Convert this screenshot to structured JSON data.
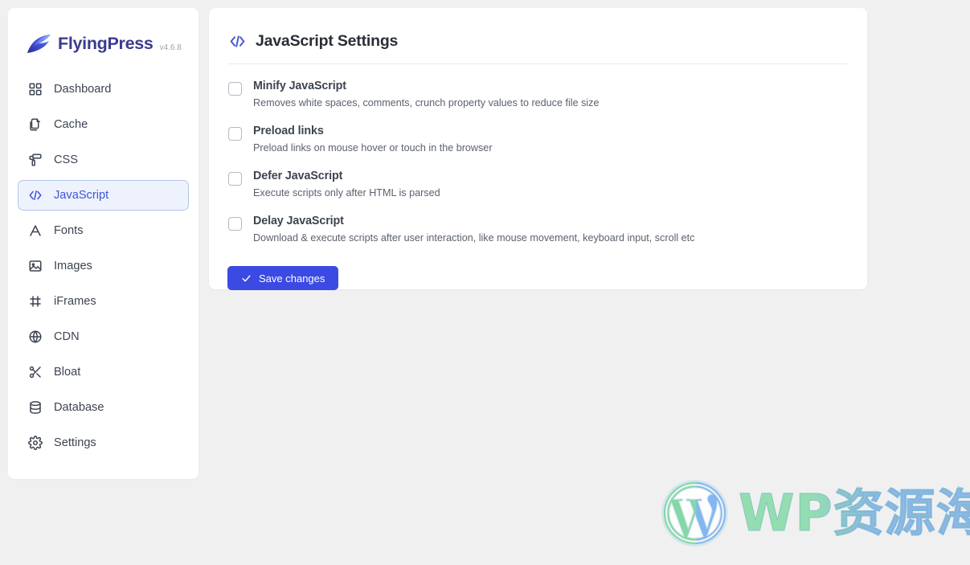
{
  "brand": {
    "name": "FlyingPress",
    "version": "v4.6.8",
    "logo_icon": "flyingpress-wing-logo"
  },
  "sidebar": {
    "items": [
      {
        "label": "Dashboard",
        "icon": "grid-icon",
        "active": false
      },
      {
        "label": "Cache",
        "icon": "copy-icon",
        "active": false
      },
      {
        "label": "CSS",
        "icon": "paint-roller-icon",
        "active": false
      },
      {
        "label": "JavaScript",
        "icon": "code-icon",
        "active": true
      },
      {
        "label": "Fonts",
        "icon": "letter-a-icon",
        "active": false
      },
      {
        "label": "Images",
        "icon": "image-icon",
        "active": false
      },
      {
        "label": "iFrames",
        "icon": "frame-icon",
        "active": false
      },
      {
        "label": "CDN",
        "icon": "globe-icon",
        "active": false
      },
      {
        "label": "Bloat",
        "icon": "scissors-icon",
        "active": false
      },
      {
        "label": "Database",
        "icon": "database-icon",
        "active": false
      },
      {
        "label": "Settings",
        "icon": "gear-icon",
        "active": false
      }
    ]
  },
  "panel": {
    "title": "JavaScript Settings",
    "title_icon": "code-icon",
    "options": [
      {
        "label": "Minify JavaScript",
        "description": "Removes white spaces, comments, crunch property values to reduce file size",
        "checked": false
      },
      {
        "label": "Preload links",
        "description": "Preload links on mouse hover or touch in the browser",
        "checked": false
      },
      {
        "label": "Defer JavaScript",
        "description": "Execute scripts only after HTML is parsed",
        "checked": false
      },
      {
        "label": "Delay JavaScript",
        "description": "Download & execute scripts after user interaction, like mouse movement, keyboard input, scroll etc",
        "checked": false
      }
    ],
    "save_label": "Save changes",
    "save_icon": "check-icon"
  },
  "watermark": {
    "text": "WP资源海",
    "logo_icon": "wordpress-logo"
  },
  "colors": {
    "accent": "#3b4ae3",
    "active_nav_bg": "#eef2fc",
    "active_nav_border": "#b4c4ec",
    "active_nav_text": "#4154d6",
    "brand_text": "#3b3b8f",
    "page_bg": "#f0f0f1",
    "card_bg": "#ffffff",
    "label_text": "#3d4451",
    "desc_text": "#5a616e"
  }
}
